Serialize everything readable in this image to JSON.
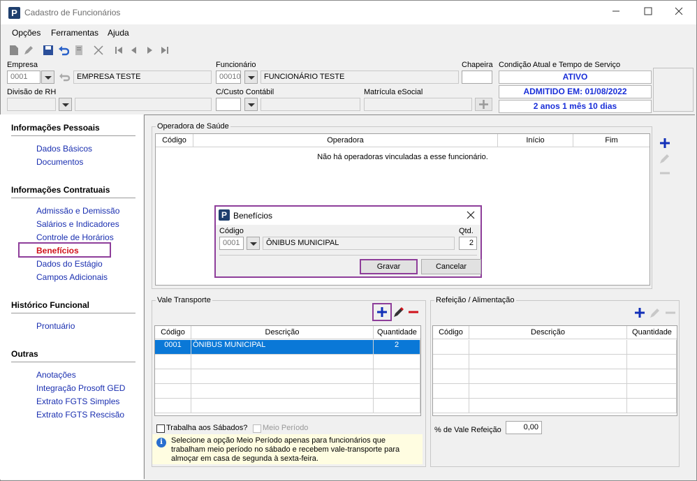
{
  "window": {
    "title": "Cadastro de Funcionários",
    "logo": "P"
  },
  "menu": {
    "opcoes": "Opções",
    "ferramentas": "Ferramentas",
    "ajuda": "Ajuda"
  },
  "header": {
    "empresa_label": "Empresa",
    "empresa_code": "0001",
    "empresa_name": "EMPRESA TESTE",
    "funcionario_label": "Funcionário",
    "funcionario_code": "00010",
    "funcionario_name": "FUNCIONÁRIO TESTE",
    "chapeira_label": "Chapeira",
    "chapeira_value": "",
    "condicao_label": "Condição Atual e Tempo de Serviço",
    "status_1": "ATIVO",
    "status_2": "ADMITIDO EM: 01/08/2022",
    "status_3": "2 anos 1 mês 10 dias",
    "divisao_label": "Divisão de RH",
    "ccusto_label": "C/Custo Contábil",
    "matricula_label": "Matrícula eSocial"
  },
  "sidebar": {
    "section_1": "Informações Pessoais",
    "items_1": [
      "Dados Básicos",
      "Documentos"
    ],
    "section_2": "Informações Contratuais",
    "items_2": [
      "Admissão e Demissão",
      "Salários e Indicadores",
      "Controle de Horários",
      "Benefícios",
      "Dados do Estágio",
      "Campos Adicionais"
    ],
    "section_3": "Histórico Funcional",
    "items_3": [
      "Prontuário"
    ],
    "section_4": "Outras",
    "items_4": [
      "Anotações",
      "Integração Prosoft GED",
      "Extrato FGTS Simples",
      "Extrato FGTS Rescisão"
    ]
  },
  "operadora": {
    "title": "Operadora de Saúde",
    "columns": [
      "Código",
      "Operadora",
      "Início",
      "Fim"
    ],
    "empty_message": "Não há operadoras vinculadas a esse funcionário."
  },
  "dialog": {
    "title": "Benefícios",
    "codigo_label": "Código",
    "codigo_value": "0001",
    "descricao_value": "ÔNIBUS MUNICIPAL",
    "qtd_label": "Qtd.",
    "qtd_value": "2",
    "save_label": "Gravar",
    "cancel_label": "Cancelar"
  },
  "vale_transporte": {
    "title": "Vale Transporte",
    "columns": [
      "Código",
      "Descrição",
      "Quantidade"
    ],
    "rows": [
      {
        "codigo": "0001",
        "descricao": "ÔNIBUS MUNICIPAL",
        "quantidade": "2"
      }
    ],
    "sabados_label": "Trabalha aos Sábados?",
    "meio_periodo_label": "Meio Período",
    "info_text": "Selecione a opção Meio Período apenas para funcionários que trabalham meio período no sábado e recebem vale-transporte para almoçar em casa de segunda à sexta-feira."
  },
  "refeicao": {
    "title": "Refeição / Alimentação",
    "columns": [
      "Código",
      "Descrição",
      "Quantidade"
    ],
    "percent_label": "% de Vale Refeição",
    "percent_value": "0,00"
  },
  "icons": {
    "add": "plus-icon",
    "edit": "pencil-icon",
    "remove": "minus-icon",
    "info": "info-icon"
  },
  "colors": {
    "accent": "#1230b8",
    "selection": "#0a78d7",
    "highlight": "#8e3e9a",
    "active_link": "#d0121b",
    "status_text": "#1a2fd8",
    "delete": "#d0121b"
  }
}
